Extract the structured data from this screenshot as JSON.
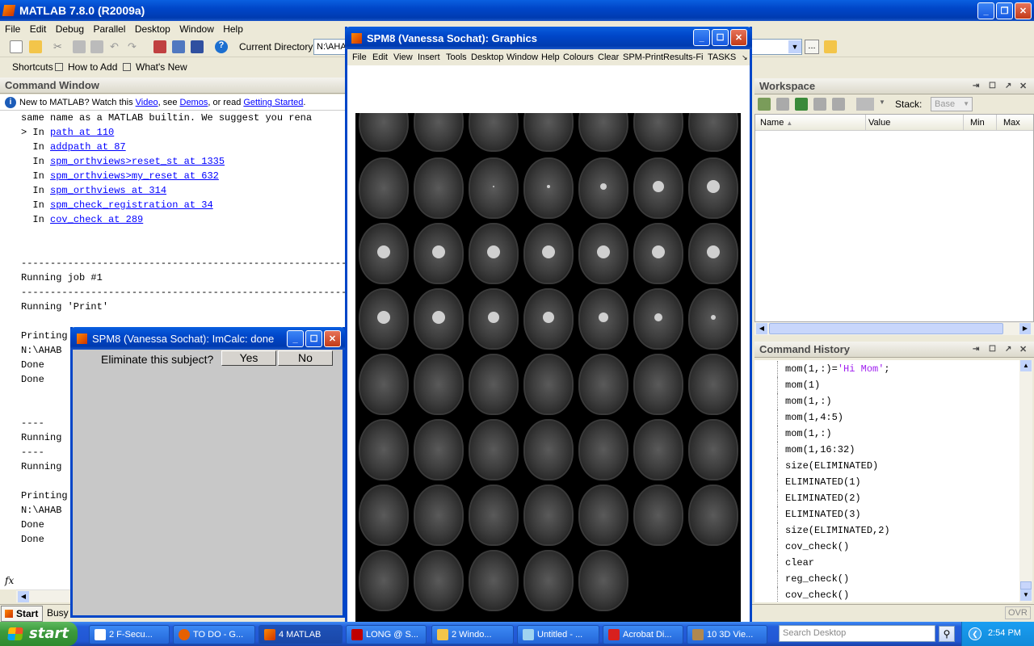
{
  "matlab": {
    "title": "MATLAB  7.8.0 (R2009a)",
    "menu": [
      "File",
      "Edit",
      "Debug",
      "Parallel",
      "Desktop",
      "Window",
      "Help"
    ],
    "current_dir_label": "Current Directory:",
    "current_dir_value": "N:\\AHA",
    "shortcuts": [
      "Shortcuts",
      "How to Add",
      "What's New"
    ]
  },
  "command_window": {
    "title": "Command Window",
    "info_prefix": "New to MATLAB? Watch this ",
    "info_video": "Video",
    "info_mid": ", see ",
    "info_demos": "Demos",
    "info_mid2": ", or read ",
    "info_gs": "Getting Started",
    "info_end": ".",
    "lines": [
      {
        "pre": "same name as a MATLAB builtin. We suggest you rena",
        "link": ""
      },
      {
        "pre": "> In ",
        "link": "path at 110"
      },
      {
        "pre": "  In ",
        "link": "addpath at 87"
      },
      {
        "pre": "  In ",
        "link": "spm_orthviews>reset_st at 1335"
      },
      {
        "pre": "  In ",
        "link": "spm_orthviews>my_reset at 632"
      },
      {
        "pre": "  In ",
        "link": "spm_orthviews at 314"
      },
      {
        "pre": "  In ",
        "link": "spm_check_registration at 34"
      },
      {
        "pre": "  In ",
        "link": "cov_check at 289"
      },
      {
        "pre": "",
        "link": ""
      },
      {
        "pre": "",
        "link": ""
      },
      {
        "pre": "--------------------------------------------------------",
        "link": ""
      },
      {
        "pre": "Running job #1",
        "link": ""
      },
      {
        "pre": "--------------------------------------------------------",
        "link": ""
      },
      {
        "pre": "Running 'Print'",
        "link": ""
      },
      {
        "pre": "",
        "link": ""
      },
      {
        "pre": "Printing",
        "link": ""
      },
      {
        "pre": "N:\\AHAB",
        "link": ""
      },
      {
        "pre": "Done",
        "link": ""
      },
      {
        "pre": "Done",
        "link": ""
      },
      {
        "pre": "",
        "link": ""
      },
      {
        "pre": "",
        "link": ""
      },
      {
        "pre": "----",
        "link": ""
      },
      {
        "pre": "Running",
        "link": ""
      },
      {
        "pre": "----",
        "link": ""
      },
      {
        "pre": "Running",
        "link": ""
      },
      {
        "pre": "",
        "link": ""
      },
      {
        "pre": "Printing",
        "link": ""
      },
      {
        "pre": "N:\\AHAB",
        "link": ""
      },
      {
        "pre": "Done",
        "link": ""
      },
      {
        "pre": "Done",
        "link": ""
      }
    ],
    "fx": "fx"
  },
  "status": {
    "start": "Start",
    "busy": "Busy",
    "ovr": "OVR"
  },
  "graphics": {
    "title": "SPM8 (Vanessa Sochat): Graphics",
    "menu": [
      "File",
      "Edit",
      "View",
      "Insert",
      "Tools",
      "Desktop",
      "Window",
      "Help",
      "Colours",
      "Clear",
      "SPM-Print",
      "Results-Fig",
      "TASKS"
    ]
  },
  "imcalc": {
    "title": "SPM8 (Vanessa Sochat): ImCalc: done",
    "question": "Eliminate this subject?",
    "yes": "Yes",
    "no": "No"
  },
  "workspace": {
    "title": "Workspace",
    "stack_label": "Stack:",
    "stack_value": "Base",
    "columns": [
      "Name",
      "Value",
      "Min",
      "Max"
    ]
  },
  "history": {
    "title": "Command History",
    "items": [
      {
        "pre": "mom(1,:)=",
        "str": "'Hi Mom'",
        "post": ";"
      },
      {
        "pre": "mom(1)",
        "str": "",
        "post": ""
      },
      {
        "pre": "mom(1,:)",
        "str": "",
        "post": ""
      },
      {
        "pre": "mom(1,4:5)",
        "str": "",
        "post": ""
      },
      {
        "pre": "mom(1,:)",
        "str": "",
        "post": ""
      },
      {
        "pre": "mom(1,16:32)",
        "str": "",
        "post": ""
      },
      {
        "pre": "size(ELIMINATED)",
        "str": "",
        "post": ""
      },
      {
        "pre": "ELIMINATED(1)",
        "str": "",
        "post": ""
      },
      {
        "pre": "ELIMINATED(2)",
        "str": "",
        "post": ""
      },
      {
        "pre": "ELIMINATED(3)",
        "str": "",
        "post": ""
      },
      {
        "pre": "size(ELIMINATED,2)",
        "str": "",
        "post": ""
      },
      {
        "pre": "cov_check()",
        "str": "",
        "post": ""
      },
      {
        "pre": "clear",
        "str": "",
        "post": ""
      },
      {
        "pre": "reg_check()",
        "str": "",
        "post": ""
      },
      {
        "pre": "cov_check()",
        "str": "",
        "post": ""
      }
    ]
  },
  "taskbar": {
    "start": "start",
    "tasks": [
      "2 F-Secu...",
      "TO DO - G...",
      "4 MATLAB",
      "LONG @ S...",
      "2 Windo...",
      "Untitled - ...",
      "Acrobat Di...",
      "10 3D Vie..."
    ],
    "search_placeholder": "Search Desktop",
    "clock": "2:54 PM"
  }
}
